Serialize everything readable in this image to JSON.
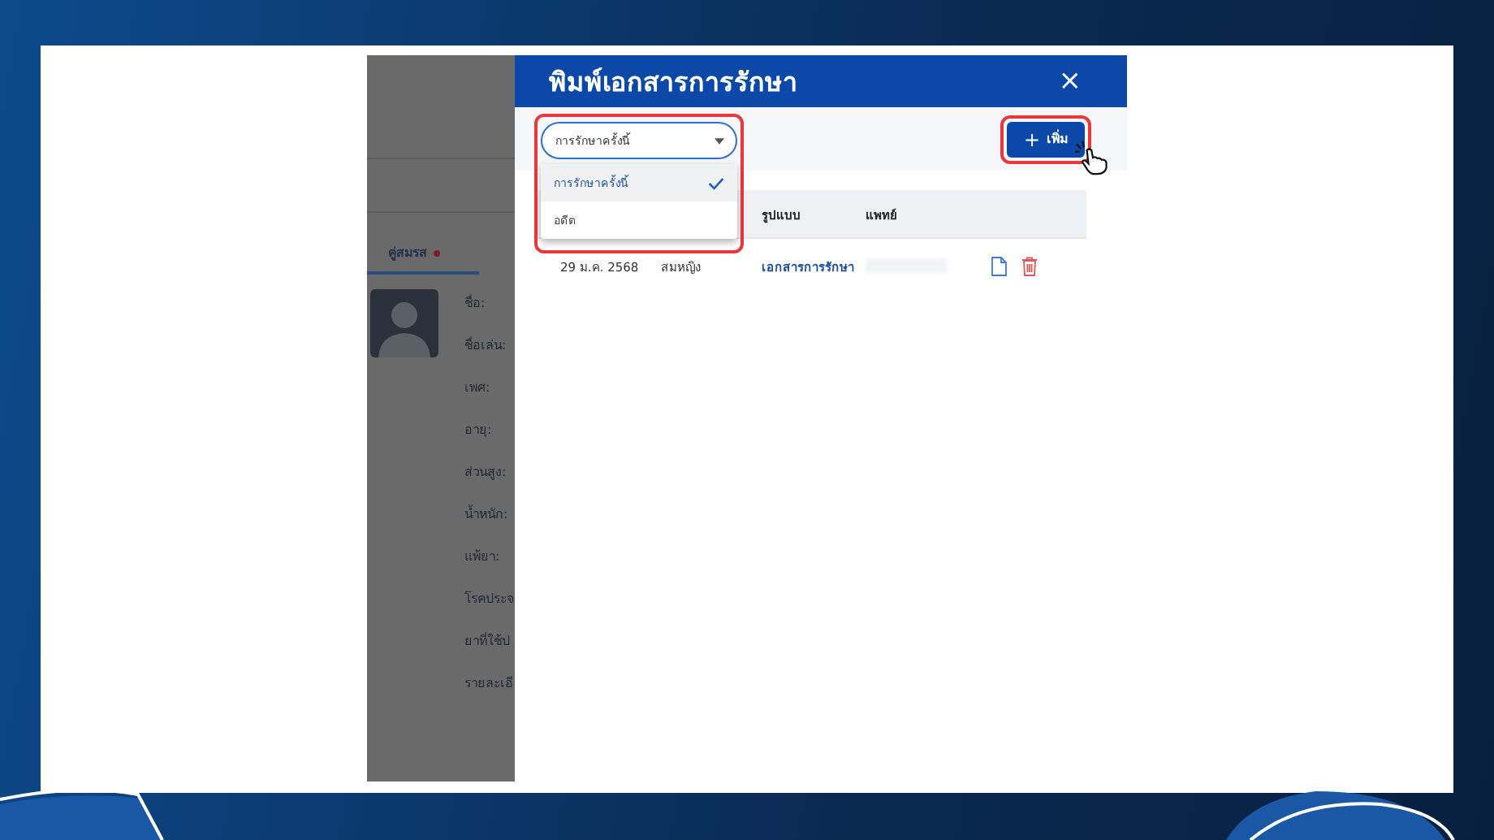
{
  "background_panel": {
    "tab": {
      "label": "คู่สมรส",
      "marked": true
    },
    "labels": [
      "ชื่อ:",
      "ชื่อเล่น:",
      "เพศ:",
      "อายุ:",
      "ส่วนสูง:",
      "น้ำหนัก:",
      "แพ้ยา:",
      "โรคประจ",
      "ยาที่ใช้ป",
      "รายละเอี"
    ]
  },
  "dialog": {
    "title": "พิมพ์เอกสารการรักษา",
    "close": "×",
    "filter": {
      "value": "การรักษาครั้งนี้",
      "options": [
        {
          "label": "การรักษาครั้งนี้",
          "selected": true
        },
        {
          "label": "อดีต",
          "selected": false
        }
      ]
    },
    "add_button": {
      "icon": "+",
      "label": "เพิ่ม"
    },
    "table": {
      "columns": [
        "",
        "",
        "รูปแบบ",
        "แพทย์"
      ],
      "rows": [
        {
          "date": "29 ม.ค. 2568",
          "patient": "สมหญิง",
          "document": "เอกสารการรักษา"
        }
      ]
    }
  }
}
